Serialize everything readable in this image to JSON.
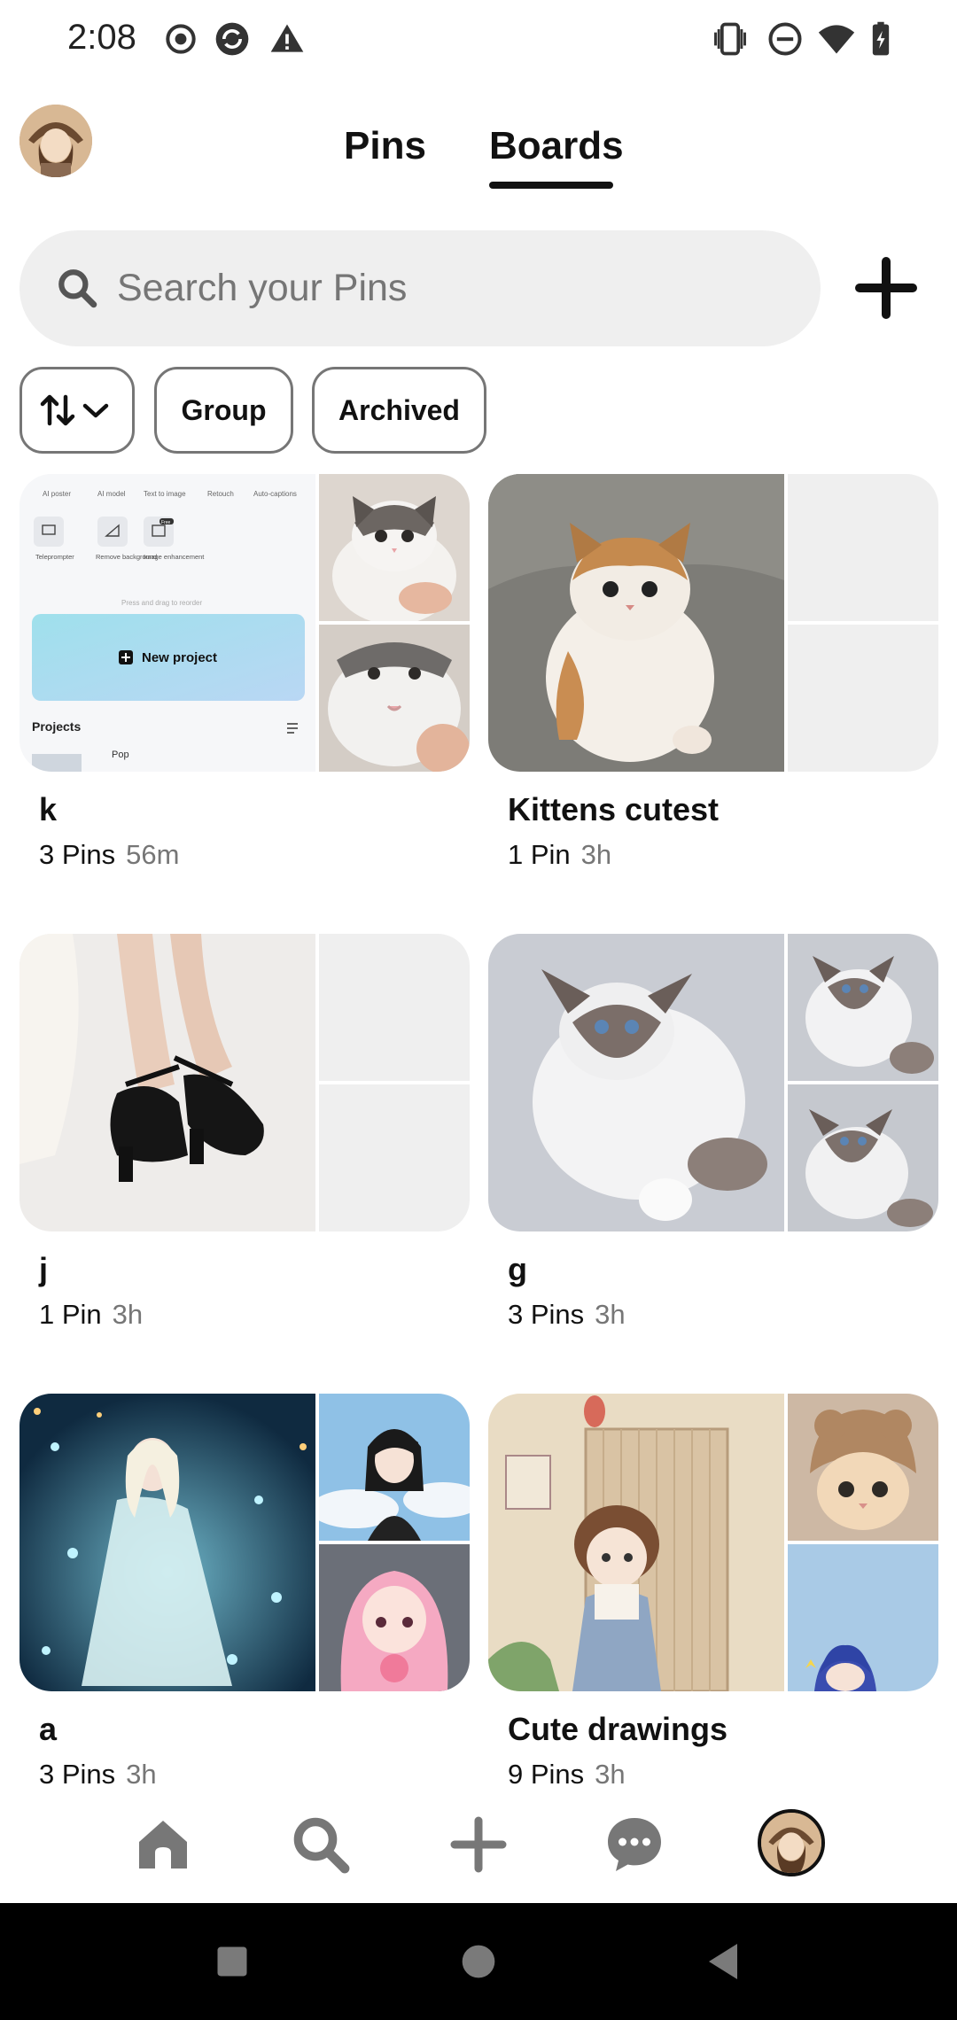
{
  "status_bar": {
    "time": "2:08",
    "left_icons": [
      "record-icon",
      "sync-icon",
      "warning-icon"
    ],
    "right_icons": [
      "vibrate-icon",
      "do-not-disturb-icon",
      "wifi-icon",
      "battery-charging-icon"
    ]
  },
  "header": {
    "tabs": [
      {
        "label": "Pins",
        "selected": false
      },
      {
        "label": "Boards",
        "selected": true
      }
    ]
  },
  "search": {
    "placeholder": "Search your Pins",
    "icon": "search-icon",
    "add_icon": "plus-icon"
  },
  "filters": {
    "sort_icon": "sort-arrows-icon",
    "chips": [
      "Group",
      "Archived"
    ]
  },
  "boards": [
    {
      "title": "k",
      "count": "3 Pins",
      "time": "56m"
    },
    {
      "title": "Kittens cutest",
      "count": "1 Pin",
      "time": "3h"
    },
    {
      "title": "j",
      "count": "1 Pin",
      "time": "3h"
    },
    {
      "title": "g",
      "count": "3 Pins",
      "time": "3h"
    },
    {
      "title": "a",
      "count": "3 Pins",
      "time": "3h"
    },
    {
      "title": "Cute drawings",
      "count": "9 Pins",
      "time": "3h"
    }
  ],
  "board1_screenshot": {
    "tools": [
      "AI poster",
      "AI model",
      "Text to image",
      "Retouch",
      "Auto-captions"
    ],
    "tools2": [
      "Teleprompter",
      "Remove background",
      "Image enhancement"
    ],
    "badge": "Free",
    "hint": "Press and drag to reorder",
    "new_project": "New project",
    "projects": "Projects",
    "item": "Pop"
  },
  "bottom_nav": [
    "home-icon",
    "search-icon",
    "plus-icon",
    "messages-icon",
    "profile-avatar"
  ],
  "colors": {
    "accent": "#111111",
    "muted": "#767676",
    "search_bg": "#efefef"
  }
}
